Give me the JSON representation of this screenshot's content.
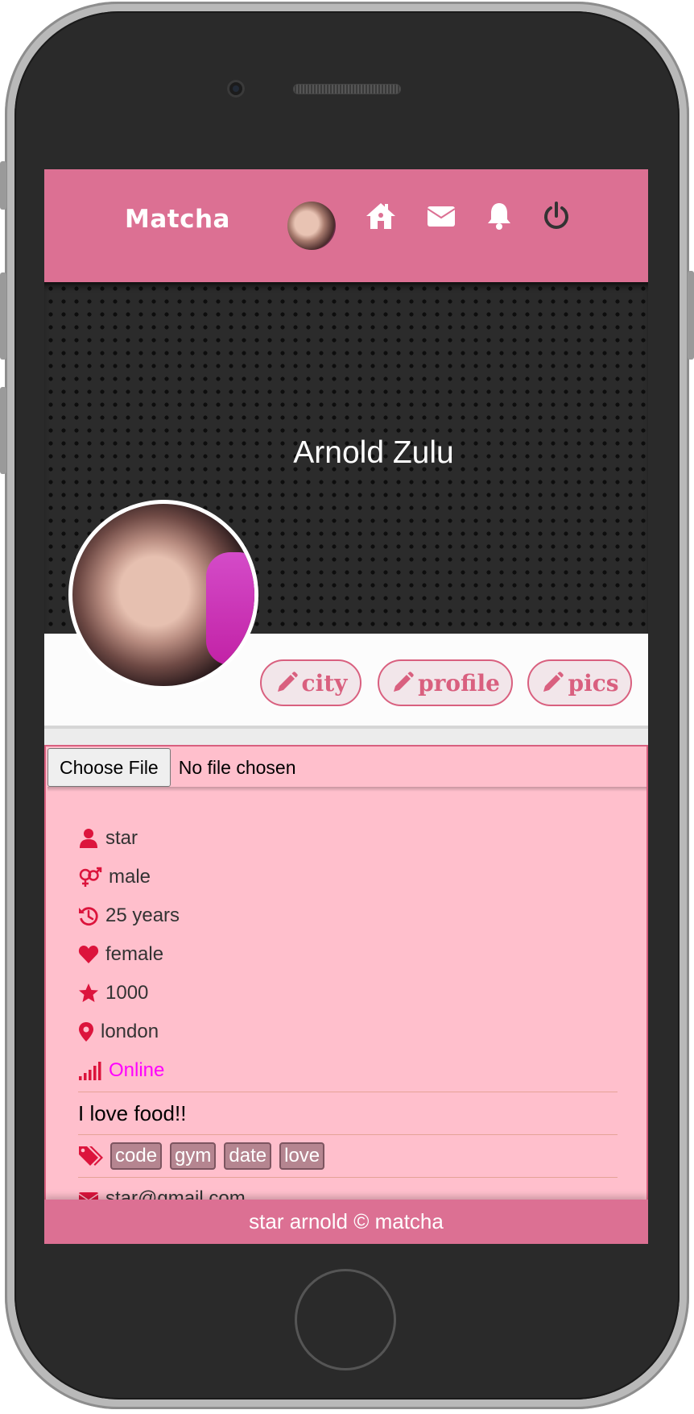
{
  "colors": {
    "accent": "#dc7093",
    "panel": "#ffbfcc",
    "icon": "#dc143c",
    "online": "#ff00ff"
  },
  "navbar": {
    "brand": "Matcha",
    "icons": [
      "home-icon",
      "envelope-icon",
      "bell-icon",
      "power-icon"
    ]
  },
  "profile": {
    "name": "Arnold Zulu"
  },
  "actions": {
    "city": "city",
    "profile": "profile",
    "pics": "pics"
  },
  "upload": {
    "button": "Choose File",
    "status": "No file chosen"
  },
  "info": {
    "username": "star",
    "gender": "male",
    "age": "25 years",
    "preference": "female",
    "rating": "1000",
    "location": "london",
    "status": "Online",
    "bio": "I love food!!",
    "tags": [
      "code",
      "gym",
      "date",
      "love"
    ],
    "email": "star@gmail.com"
  },
  "footer": {
    "text": "star arnold © matcha"
  }
}
